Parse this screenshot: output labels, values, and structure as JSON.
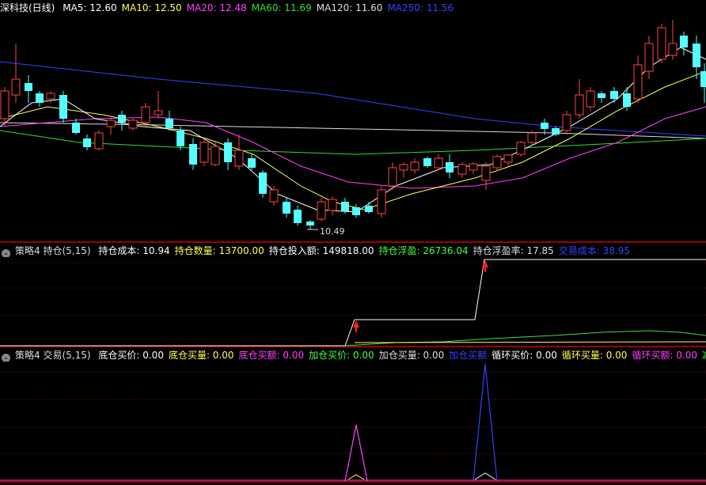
{
  "main": {
    "title": "深科技(日线)",
    "ma": [
      {
        "label": "MA5: 12.60",
        "color": "#ffffff"
      },
      {
        "label": "MA10: 12.50",
        "color": "#ffff55"
      },
      {
        "label": "MA20: 12.48",
        "color": "#ff44ff"
      },
      {
        "label": "MA60: 11.69",
        "color": "#33dd33"
      },
      {
        "label": "MA120: 11.60",
        "color": "#dddddd"
      },
      {
        "label": "MA250: 11.56",
        "color": "#3344ff"
      }
    ],
    "low_label": "10.49"
  },
  "panel2": {
    "title": "策略4 持仓(5,15)",
    "items": [
      {
        "label": "持仓成本: 10.94",
        "color": "#ffffff"
      },
      {
        "label": "持仓数量: 13700.00",
        "color": "#ffff55"
      },
      {
        "label": "持仓投入额: 149818.00",
        "color": "#ffffff"
      },
      {
        "label": "持仓浮盈: 26736.04",
        "color": "#44ff44"
      },
      {
        "label": "持仓浮盈率: 17.85",
        "color": "#dddddd"
      },
      {
        "label": "交易成本: 38.95",
        "color": "#3344ff"
      }
    ]
  },
  "panel3": {
    "title": "策略4 交易(5,15)",
    "items": [
      {
        "label": "底仓买价: 0.00",
        "color": "#ffffff"
      },
      {
        "label": "底仓买量: 0.00",
        "color": "#ffff55"
      },
      {
        "label": "底仓买额: 0.00",
        "color": "#ff44ff"
      },
      {
        "label": "加仓买价: 0.00",
        "color": "#44ff44"
      },
      {
        "label": "加仓买量: 0.00",
        "color": "#dddddd"
      },
      {
        "label": "加仓买额",
        "color": "#3344ff"
      },
      {
        "label": "循环买价: 0.00",
        "color": "#ffffff"
      },
      {
        "label": "循环买量: 0.00",
        "color": "#ffff55"
      },
      {
        "label": "循环买额: 0.00",
        "color": "#ff44ff"
      },
      {
        "label": "减仓卖",
        "color": "#44ff44"
      }
    ]
  },
  "colors": {
    "up": "#ff4444",
    "down": "#55ffff",
    "grid": "#8b0000",
    "divider": "#a00000"
  }
}
